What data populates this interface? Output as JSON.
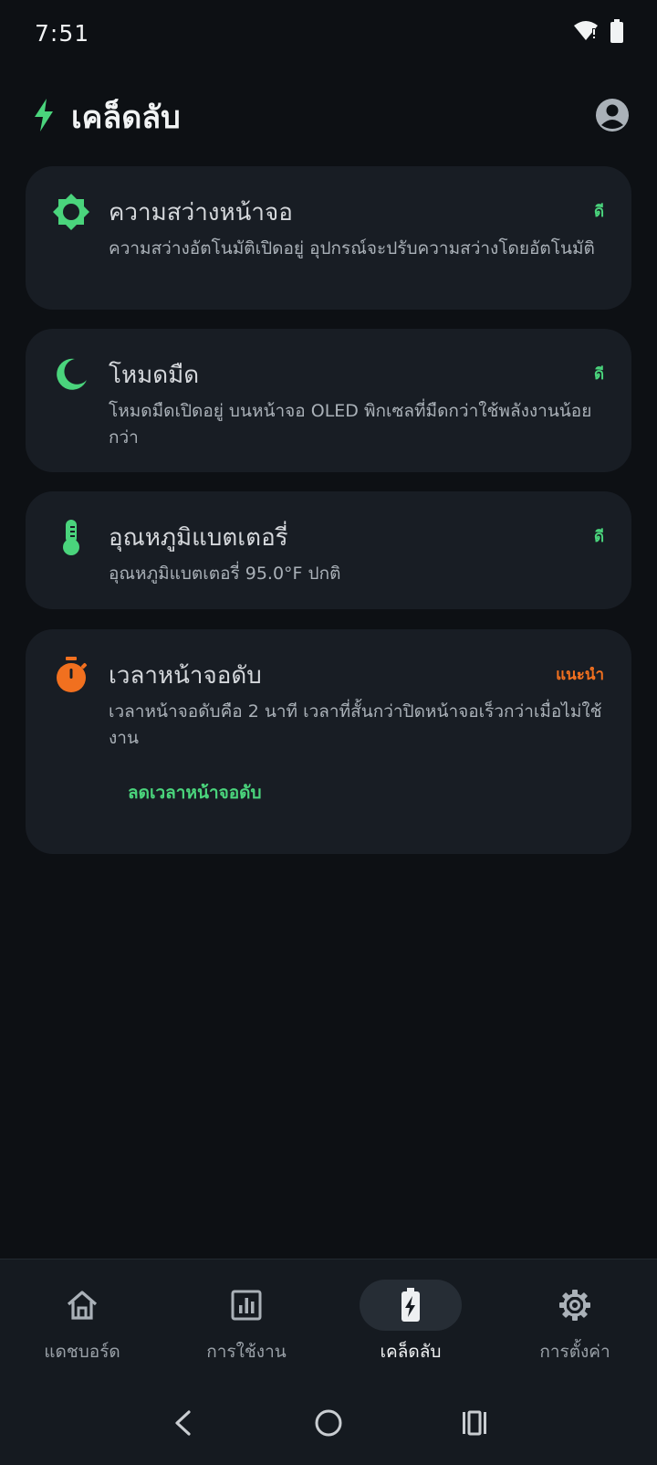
{
  "status_bar": {
    "time": "7:51"
  },
  "header": {
    "title": "เคล็ดลับ",
    "icon": "bolt-icon",
    "accent": "#4ad47c"
  },
  "tips": [
    {
      "icon": "brightness-icon",
      "title": "ความสว่างหน้าจอ",
      "badge": "ดี",
      "description": "ความสว่างอัตโนมัติเปิดอยู่ อุปกรณ์จะปรับความสว่างโดยอัตโนมัติ"
    },
    {
      "icon": "moon-icon",
      "title": "โหมดมืด",
      "badge": "ดี",
      "description": "โหมดมืดเปิดอยู่ บนหน้าจอ OLED พิกเซลที่มืดกว่าใช้พลังงานน้อยกว่า"
    },
    {
      "icon": "thermometer-icon",
      "title": "อุณหภูมิแบตเตอรี่",
      "badge": "ดี",
      "description": "อุณหภูมิแบตเตอรี่ 95.0°F ปกติ"
    },
    {
      "icon": "timer-icon",
      "title": "เวลาหน้าจอดับ",
      "badge": "แนะนำ",
      "description": "เวลาหน้าจอดับคือ 2 นาที เวลาที่สั้นกว่าปิดหน้าจอเร็วกว่าเมื่อไม่ใช้งาน",
      "action": "ลดเวลาหน้าจอดับ"
    }
  ],
  "bottom_nav": {
    "items": [
      {
        "label": "แดชบอร์ด",
        "icon": "home-icon"
      },
      {
        "label": "การใช้งาน",
        "icon": "chart-icon"
      },
      {
        "label": "เคล็ดลับ",
        "icon": "battery-bolt-icon"
      },
      {
        "label": "การตั้งค่า",
        "icon": "gear-icon"
      }
    ],
    "active": "เคล็ดลับ"
  },
  "colors": {
    "good": "#4ad47c",
    "warn": "#f1701f",
    "card": "#181d24",
    "background": "#0d1014"
  }
}
